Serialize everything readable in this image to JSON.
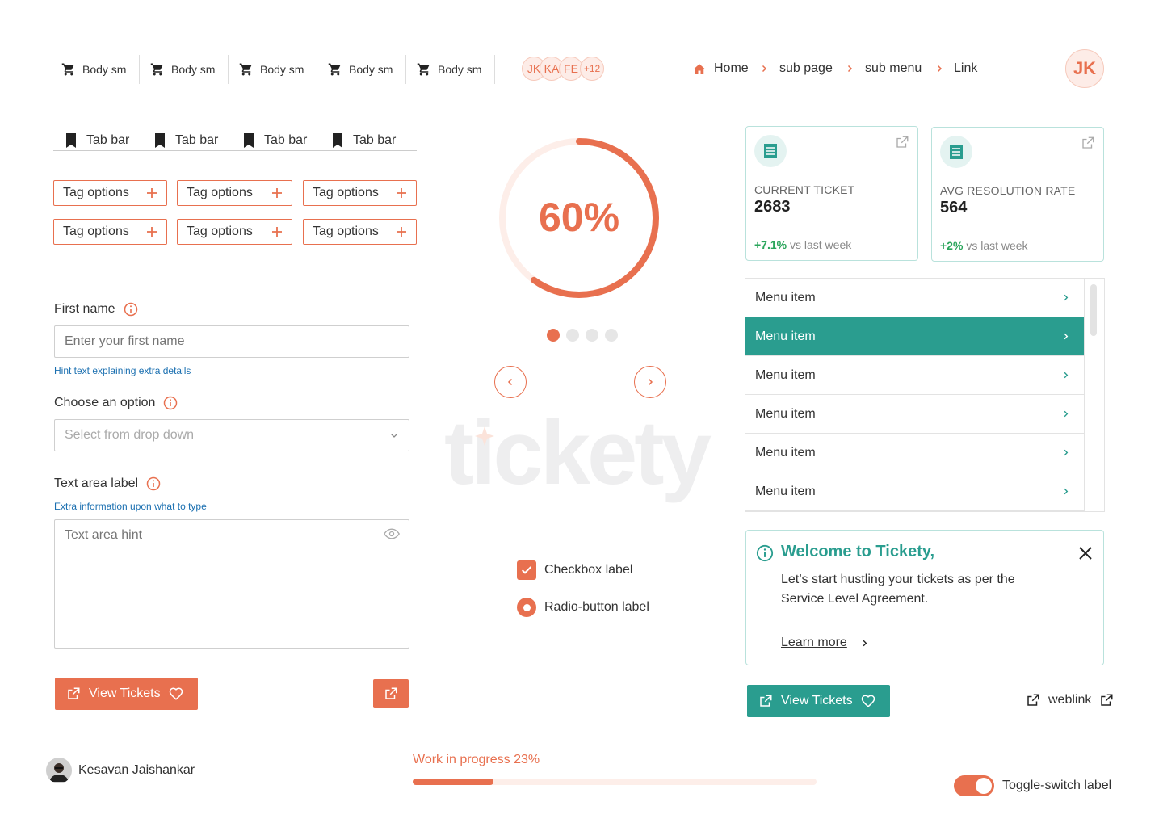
{
  "colors": {
    "accent": "#e8704f",
    "accent_light": "#fdece7",
    "teal": "#2a9d8f",
    "success": "#2aa55b",
    "hint": "#1a6fb0"
  },
  "top_nav": {
    "items": [
      {
        "icon": "cart-icon",
        "label": "Body sm"
      },
      {
        "icon": "cart-icon",
        "label": "Body sm"
      },
      {
        "icon": "cart-icon",
        "label": "Body sm"
      },
      {
        "icon": "cart-icon",
        "label": "Body sm"
      },
      {
        "icon": "cart-icon",
        "label": "Body sm"
      }
    ]
  },
  "avatar_group": {
    "avatars": [
      "JK",
      "KA",
      "FE"
    ],
    "overflow": "+12"
  },
  "breadcrumb": {
    "home": "Home",
    "items": [
      "sub page",
      "sub menu"
    ],
    "link": "Link"
  },
  "user_avatar": "JK",
  "tabs": [
    "Tab bar",
    "Tab bar",
    "Tab bar",
    "Tab bar"
  ],
  "tags": [
    "Tag options",
    "Tag options",
    "Tag options",
    "Tag options",
    "Tag options",
    "Tag options"
  ],
  "form": {
    "first_name": {
      "label": "First name",
      "placeholder": "Enter your first name",
      "hint": "Hint text explaining extra details"
    },
    "select": {
      "label": "Choose an option",
      "placeholder": "Select from drop down"
    },
    "textarea": {
      "label": "Text area label",
      "extra": "Extra information upon what to type",
      "placeholder": "Text area hint"
    }
  },
  "view_tickets_label": "View Tickets",
  "progress_ring": {
    "value": 0.6,
    "label": "60%"
  },
  "carousel": {
    "count": 4,
    "active": 0
  },
  "brand_watermark": "ticketу",
  "checkbox": {
    "label": "Checkbox label",
    "checked": true
  },
  "radio": {
    "label": "Radio-button label",
    "selected": true
  },
  "stat_cards": [
    {
      "title": "CURRENT TICKET",
      "value": "2683",
      "trend": "+7.1%",
      "trend_text": "vs last week"
    },
    {
      "title": "AVG RESOLUTION RATE",
      "value": "564",
      "trend": "+2%",
      "trend_text": "vs last week"
    }
  ],
  "menu_items": [
    {
      "label": "Menu item",
      "active": false
    },
    {
      "label": "Menu item",
      "active": true
    },
    {
      "label": "Menu item",
      "active": false
    },
    {
      "label": "Menu item",
      "active": false
    },
    {
      "label": "Menu item",
      "active": false
    },
    {
      "label": "Menu item",
      "active": false
    }
  ],
  "notification": {
    "title": "Welcome to Tickety,",
    "body": "Let’s start hustling your tickets as per the Service Level Agreement.",
    "link": "Learn more"
  },
  "weblink_label": "weblink",
  "user": {
    "name": "Kesavan Jaishankar"
  },
  "progress_bar": {
    "label": "Work in progress 23%",
    "value": 0.2
  },
  "toggle": {
    "label": "Toggle-switch label",
    "on": true
  }
}
